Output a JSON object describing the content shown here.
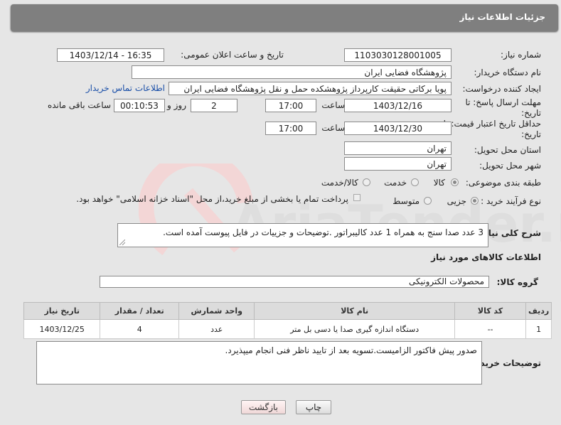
{
  "header": {
    "title": "جزئیات اطلاعات نیاز"
  },
  "need_number": {
    "label": "شماره نیاز:",
    "value": "1103030128001005"
  },
  "announce": {
    "label": "تاریخ و ساعت اعلان عمومی:",
    "value": "1403/12/14 - 16:35"
  },
  "buyer_org": {
    "label": "نام دستگاه خریدار:",
    "value": "پژوهشگاه فضایی ایران"
  },
  "creator": {
    "label": "ایجاد کننده درخواست:",
    "value": "پویا برکاتی حقیقت کارپرداز پژوهشکده حمل و نقل پژوهشگاه فضایی ایران",
    "contact_link": "اطلاعات تماس خریدار"
  },
  "reply_deadline": {
    "label_line1": "مهلت ارسال پاسخ: تا",
    "label_line2": "تاریخ:",
    "date": "1403/12/16",
    "time_label": "ساعت",
    "time": "17:00",
    "days": "2",
    "days_label": "روز و",
    "remaining": "00:10:53",
    "remaining_label": "ساعت باقی مانده"
  },
  "price_validity": {
    "label_line1": "حداقل تاریخ اعتبار قیمت: تا",
    "label_line2": "تاریخ:",
    "date": "1403/12/30",
    "time_label": "ساعت",
    "time": "17:00"
  },
  "province": {
    "label": "استان محل تحویل:",
    "value": "تهران"
  },
  "city": {
    "label": "شهر محل تحویل:",
    "value": "تهران"
  },
  "category": {
    "label": "طبقه بندی موضوعی:",
    "options": [
      "کالا",
      "خدمت",
      "کالا/خدمت"
    ],
    "selected": "کالا"
  },
  "purchase_process": {
    "label": "نوع فرآیند خرید :",
    "options": [
      "جزیی",
      "متوسط"
    ],
    "selected": "جزیی",
    "note": "پرداخت تمام یا بخشی از مبلغ خرید،از محل \"اسناد خزانه اسلامی\" خواهد بود."
  },
  "description": {
    "label": "شرح کلی نیاز:",
    "value": "3 عدد صدا سنج به همراه 1 عدد کالیبراتور .توضیحات و جزییات در فایل پیوست آمده است."
  },
  "goods_section": {
    "title": "اطلاعات کالاهای مورد نیاز"
  },
  "goods_group": {
    "label": "گروه کالا:",
    "value": "محصولات الکترونیکی"
  },
  "table": {
    "headers": [
      "ردیف",
      "کد کالا",
      "نام کالا",
      "واحد شمارش",
      "تعداد / مقدار",
      "تاریخ نیاز"
    ],
    "rows": [
      [
        "1",
        "--",
        "دستگاه اندازه گیری صدا یا دسی بل متر",
        "عدد",
        "4",
        "1403/12/25"
      ]
    ]
  },
  "buyer_notes": {
    "label": "توضیحات خریدار:",
    "value": "صدور پیش فاکتور الزامیست.تسویه بعد از تایید ناظر فنی انجام میپذیرد."
  },
  "buttons": {
    "print": "چاپ",
    "back": "بازگشت"
  },
  "watermark": {
    "text": "AriaTender.neT"
  }
}
